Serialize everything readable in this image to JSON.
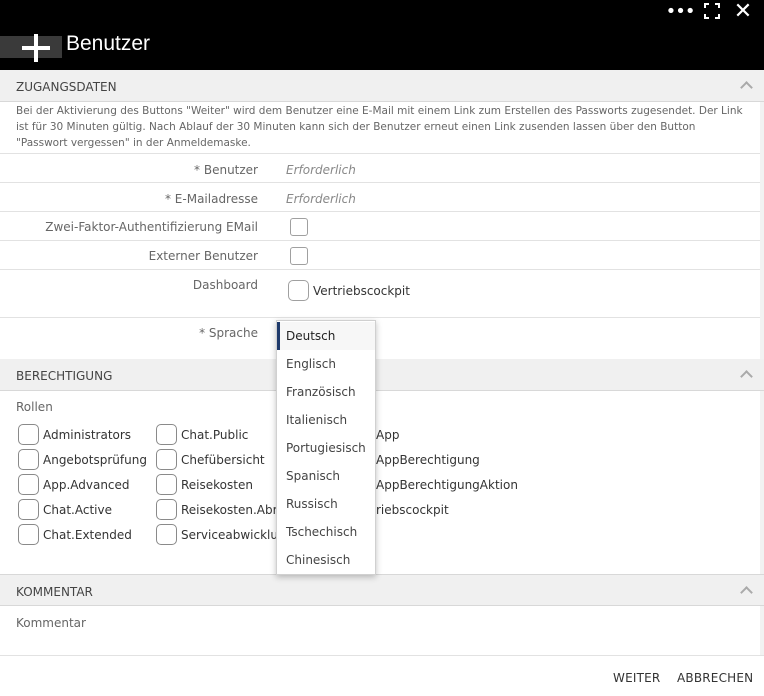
{
  "window": {
    "title": "Benutzer",
    "more_icon": "more-dots-icon",
    "expand_icon": "fullscreen-icon",
    "close_icon": "close-icon",
    "more_glyph": "•••",
    "close_glyph": "✕"
  },
  "zugangsdaten": {
    "header": "ZUGANGSDATEN",
    "info": "Bei der Aktivierung des Buttons \"Weiter\" wird dem Benutzer eine E-Mail mit einem Link zum Erstellen des Passworts zugesendet. Der Link ist für 30 Minuten gültig. Nach Ablauf der 30 Minuten kann sich der Benutzer erneut einen Link zusenden lassen über den Button \"Passwort vergessen\" in der Anmeldemaske.",
    "benutzer_label": "* Benutzer",
    "benutzer_placeholder": "Erforderlich",
    "email_label": "* E-Mailadresse",
    "email_placeholder": "Erforderlich",
    "twofa_label": "Zwei-Faktor-Authentifizierung EMail",
    "extern_label": "Externer Benutzer",
    "dashboard_label": "Dashboard",
    "dashboard_option": "Vertriebscockpit",
    "sprache_label": "* Sprache"
  },
  "sprache_dropdown": {
    "selected": "Deutsch",
    "options": [
      "Deutsch",
      "Englisch",
      "Französisch",
      "Italienisch",
      "Portugiesisch",
      "Spanisch",
      "Russisch",
      "Tschechisch",
      "Chinesisch"
    ]
  },
  "berechtigung": {
    "header": "BERECHTIGUNG",
    "rollen_label": "Rollen",
    "col1": [
      "Administrators",
      "Angebotsprüfung",
      "App.Advanced",
      "Chat.Active",
      "Chat.Extended"
    ],
    "col2": [
      "Chat.Public",
      "Chefübersicht",
      "Reisekosten",
      "Reisekosten.Abrec",
      "Serviceabwicklung"
    ],
    "col3": [
      "App",
      "AppBerechtigung",
      "AppBerechtigungAktion",
      "riebscockpit"
    ]
  },
  "kommentar": {
    "header": "KOMMENTAR",
    "placeholder": "Kommentar"
  },
  "footer": {
    "weiter": "WEITER",
    "abbrechen": "ABBRECHEN"
  }
}
